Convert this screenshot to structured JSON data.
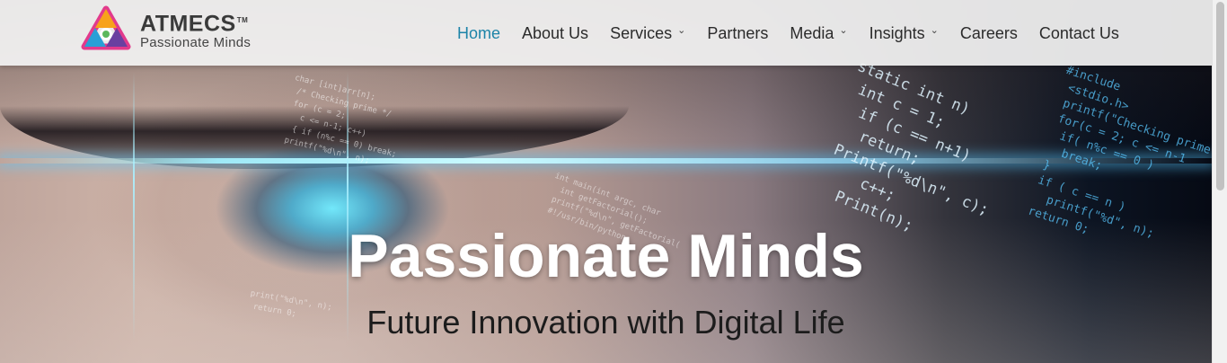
{
  "brand": {
    "name": "ATMECS",
    "trademark": "TM",
    "tagline": "Passionate Minds"
  },
  "nav": {
    "items": [
      {
        "label": "Home",
        "active": true,
        "has_dropdown": false
      },
      {
        "label": "About Us",
        "active": false,
        "has_dropdown": false
      },
      {
        "label": "Services",
        "active": false,
        "has_dropdown": true
      },
      {
        "label": "Partners",
        "active": false,
        "has_dropdown": false
      },
      {
        "label": "Media",
        "active": false,
        "has_dropdown": true
      },
      {
        "label": "Insights",
        "active": false,
        "has_dropdown": true
      },
      {
        "label": "Careers",
        "active": false,
        "has_dropdown": false
      },
      {
        "label": "Contact Us",
        "active": false,
        "has_dropdown": false
      }
    ],
    "dropdown_icon": "chevron-down-icon"
  },
  "hero": {
    "title": "Passionate Minds",
    "subtitle": "Future Innovation with Digital Life"
  },
  "colors": {
    "accent": "#1d84a8",
    "nav_text": "#2b2b2b",
    "header_bg": "#f2f2f2",
    "hero_title": "#ffffff",
    "hero_subtitle": "#1c1c1c"
  }
}
